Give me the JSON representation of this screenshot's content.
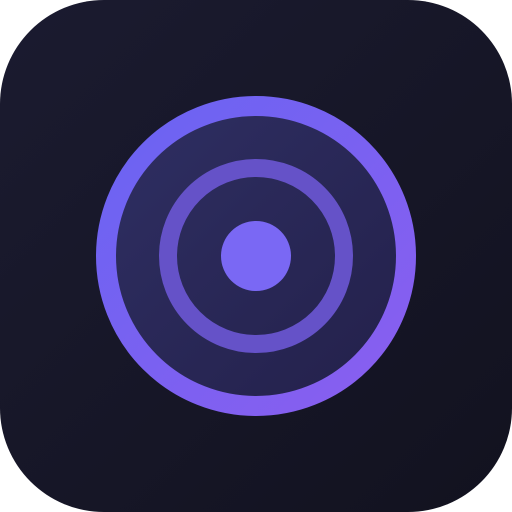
{
  "icon": {
    "symbol": "concentric-target-icon",
    "colors": {
      "background_top": "#1b1b30",
      "background_bottom": "#12121f",
      "disc_top": "#2f2f63",
      "disc_bottom": "#23204a",
      "outer_ring_start": "#6a64f2",
      "outer_ring_end": "#8a5ef0",
      "inner_ring": "#6552c8",
      "center_dot": "#7a68f4"
    }
  }
}
